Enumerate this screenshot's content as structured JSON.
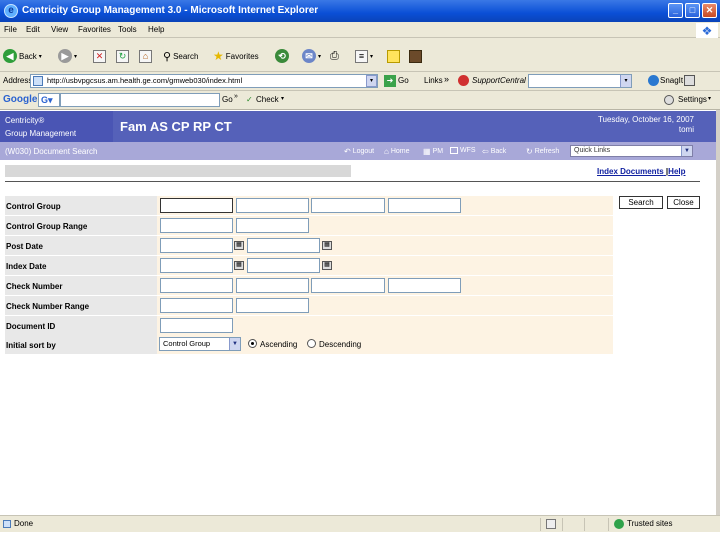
{
  "window": {
    "title": "Centricity Group Management 3.0 - Microsoft Internet Explorer"
  },
  "menu": [
    "File",
    "Edit",
    "View",
    "Favorites",
    "Tools",
    "Help"
  ],
  "toolbar": {
    "back": "Back",
    "search": "Search",
    "favorites": "Favorites"
  },
  "address": {
    "label": "Address",
    "url": "http://usbvpgcsus.am.health.ge.com/gmweb030/index.html",
    "go": "Go",
    "links": "Links",
    "support_central": "SupportCentral",
    "snagit": "SnagIt"
  },
  "google": {
    "label": "Google",
    "go": "Go",
    "check": "Check",
    "settings": "Settings"
  },
  "app": {
    "brand_line1": "Centricity®",
    "brand_line2": "Group Management",
    "title": "Fam AS CP RP CT",
    "date": "Tuesday, October 16, 2007",
    "user": "tomi"
  },
  "nav": {
    "breadcrumb": "(W030) Document Search",
    "links": [
      "Logout",
      "Home",
      "PM",
      "WFS",
      "Back",
      "Refresh"
    ],
    "quick_links": "Quick Links"
  },
  "top_links": {
    "index_documents": "Index Documents",
    "help": "Help"
  },
  "form": {
    "labels": {
      "control_group": "Control Group",
      "control_group_range": "Control Group Range",
      "post_date": "Post Date",
      "index_date": "Index Date",
      "check_number": "Check Number",
      "check_number_range": "Check Number Range",
      "document_id": "Document ID",
      "initial_sort_by": "Initial sort by"
    },
    "sort_selected": "Control Group",
    "ascending": "Ascending",
    "descending": "Descending",
    "search_button": "Search",
    "close_button": "Close"
  },
  "status": {
    "left": "Done",
    "zone": "Trusted sites"
  }
}
